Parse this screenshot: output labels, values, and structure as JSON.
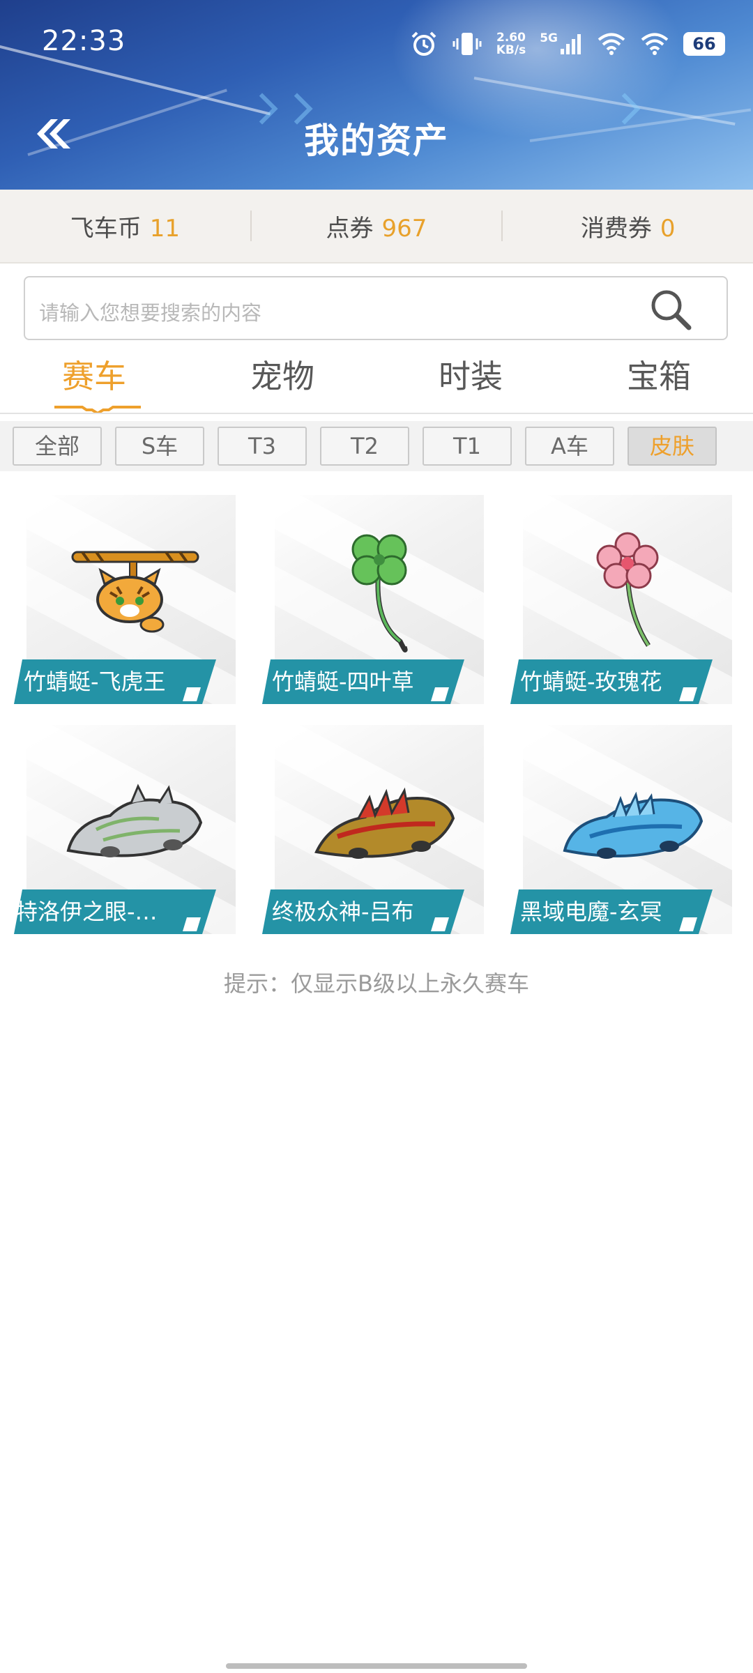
{
  "status_bar": {
    "time": "22:33",
    "net_speed_value": "2.60",
    "net_speed_unit": "KB/s",
    "network_type": "5G",
    "battery": "66",
    "icons": [
      "alarm-icon",
      "vibrate-icon",
      "signal-icon",
      "wifi-icon",
      "wifi-icon",
      "battery-icon"
    ]
  },
  "header": {
    "title": "我的资产",
    "back_icon": "double-chevron-left-icon"
  },
  "balances": [
    {
      "label": "飞车币",
      "value": "11"
    },
    {
      "label": "点券",
      "value": "967"
    },
    {
      "label": "消费券",
      "value": "0"
    }
  ],
  "search": {
    "placeholder": "请输入您想要搜索的内容",
    "icon": "search-icon"
  },
  "tabs": [
    {
      "label": "赛车",
      "active": true
    },
    {
      "label": "宠物",
      "active": false
    },
    {
      "label": "时装",
      "active": false
    },
    {
      "label": "宝箱",
      "active": false
    }
  ],
  "filters": [
    {
      "label": "全部",
      "active": false
    },
    {
      "label": "S车",
      "active": false
    },
    {
      "label": "T3",
      "active": false
    },
    {
      "label": "T2",
      "active": false
    },
    {
      "label": "T1",
      "active": false
    },
    {
      "label": "A车",
      "active": false
    },
    {
      "label": "皮肤",
      "active": true
    }
  ],
  "items": [
    {
      "name": "竹蜻蜓-飞虎王",
      "art": "tiger-copter-icon"
    },
    {
      "name": "竹蜻蜓-四叶草",
      "art": "clover-icon"
    },
    {
      "name": "竹蜻蜓-玫瑰花",
      "art": "flower-icon"
    },
    {
      "name": "特洛伊之眼-…",
      "art": "silver-car-icon"
    },
    {
      "name": "终极众神-吕布",
      "art": "flame-car-icon"
    },
    {
      "name": "黑域电魔-玄冥",
      "art": "blue-car-icon"
    }
  ],
  "hint": "提示：仅显示B级以上永久赛车",
  "colors": {
    "accent": "#eea02c",
    "label_teal": "#2493a6",
    "header_blue": "#2f5fb4"
  }
}
